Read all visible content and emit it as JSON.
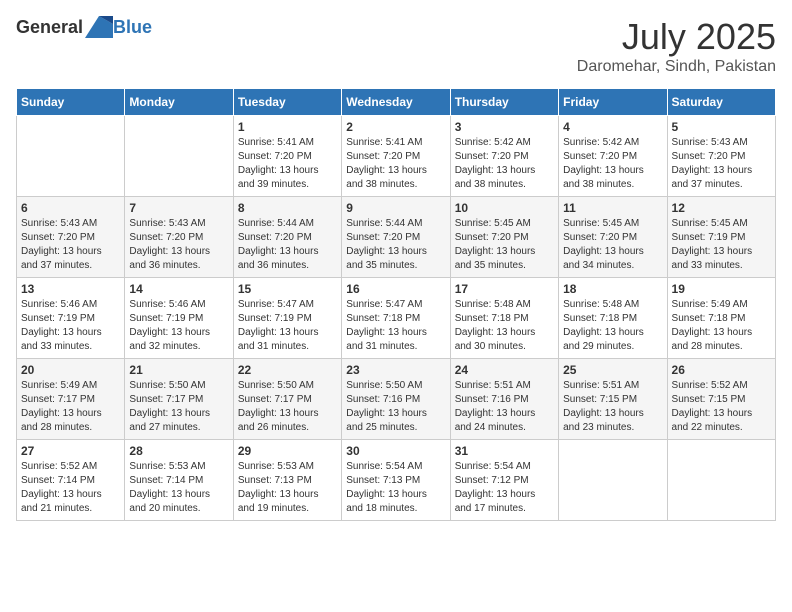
{
  "header": {
    "logo_general": "General",
    "logo_blue": "Blue",
    "month": "July 2025",
    "location": "Daromehar, Sindh, Pakistan"
  },
  "days_of_week": [
    "Sunday",
    "Monday",
    "Tuesday",
    "Wednesday",
    "Thursday",
    "Friday",
    "Saturday"
  ],
  "weeks": [
    [
      {
        "day": "",
        "info": ""
      },
      {
        "day": "",
        "info": ""
      },
      {
        "day": "1",
        "info": "Sunrise: 5:41 AM\nSunset: 7:20 PM\nDaylight: 13 hours and 39 minutes."
      },
      {
        "day": "2",
        "info": "Sunrise: 5:41 AM\nSunset: 7:20 PM\nDaylight: 13 hours and 38 minutes."
      },
      {
        "day": "3",
        "info": "Sunrise: 5:42 AM\nSunset: 7:20 PM\nDaylight: 13 hours and 38 minutes."
      },
      {
        "day": "4",
        "info": "Sunrise: 5:42 AM\nSunset: 7:20 PM\nDaylight: 13 hours and 38 minutes."
      },
      {
        "day": "5",
        "info": "Sunrise: 5:43 AM\nSunset: 7:20 PM\nDaylight: 13 hours and 37 minutes."
      }
    ],
    [
      {
        "day": "6",
        "info": "Sunrise: 5:43 AM\nSunset: 7:20 PM\nDaylight: 13 hours and 37 minutes."
      },
      {
        "day": "7",
        "info": "Sunrise: 5:43 AM\nSunset: 7:20 PM\nDaylight: 13 hours and 36 minutes."
      },
      {
        "day": "8",
        "info": "Sunrise: 5:44 AM\nSunset: 7:20 PM\nDaylight: 13 hours and 36 minutes."
      },
      {
        "day": "9",
        "info": "Sunrise: 5:44 AM\nSunset: 7:20 PM\nDaylight: 13 hours and 35 minutes."
      },
      {
        "day": "10",
        "info": "Sunrise: 5:45 AM\nSunset: 7:20 PM\nDaylight: 13 hours and 35 minutes."
      },
      {
        "day": "11",
        "info": "Sunrise: 5:45 AM\nSunset: 7:20 PM\nDaylight: 13 hours and 34 minutes."
      },
      {
        "day": "12",
        "info": "Sunrise: 5:45 AM\nSunset: 7:19 PM\nDaylight: 13 hours and 33 minutes."
      }
    ],
    [
      {
        "day": "13",
        "info": "Sunrise: 5:46 AM\nSunset: 7:19 PM\nDaylight: 13 hours and 33 minutes."
      },
      {
        "day": "14",
        "info": "Sunrise: 5:46 AM\nSunset: 7:19 PM\nDaylight: 13 hours and 32 minutes."
      },
      {
        "day": "15",
        "info": "Sunrise: 5:47 AM\nSunset: 7:19 PM\nDaylight: 13 hours and 31 minutes."
      },
      {
        "day": "16",
        "info": "Sunrise: 5:47 AM\nSunset: 7:18 PM\nDaylight: 13 hours and 31 minutes."
      },
      {
        "day": "17",
        "info": "Sunrise: 5:48 AM\nSunset: 7:18 PM\nDaylight: 13 hours and 30 minutes."
      },
      {
        "day": "18",
        "info": "Sunrise: 5:48 AM\nSunset: 7:18 PM\nDaylight: 13 hours and 29 minutes."
      },
      {
        "day": "19",
        "info": "Sunrise: 5:49 AM\nSunset: 7:18 PM\nDaylight: 13 hours and 28 minutes."
      }
    ],
    [
      {
        "day": "20",
        "info": "Sunrise: 5:49 AM\nSunset: 7:17 PM\nDaylight: 13 hours and 28 minutes."
      },
      {
        "day": "21",
        "info": "Sunrise: 5:50 AM\nSunset: 7:17 PM\nDaylight: 13 hours and 27 minutes."
      },
      {
        "day": "22",
        "info": "Sunrise: 5:50 AM\nSunset: 7:17 PM\nDaylight: 13 hours and 26 minutes."
      },
      {
        "day": "23",
        "info": "Sunrise: 5:50 AM\nSunset: 7:16 PM\nDaylight: 13 hours and 25 minutes."
      },
      {
        "day": "24",
        "info": "Sunrise: 5:51 AM\nSunset: 7:16 PM\nDaylight: 13 hours and 24 minutes."
      },
      {
        "day": "25",
        "info": "Sunrise: 5:51 AM\nSunset: 7:15 PM\nDaylight: 13 hours and 23 minutes."
      },
      {
        "day": "26",
        "info": "Sunrise: 5:52 AM\nSunset: 7:15 PM\nDaylight: 13 hours and 22 minutes."
      }
    ],
    [
      {
        "day": "27",
        "info": "Sunrise: 5:52 AM\nSunset: 7:14 PM\nDaylight: 13 hours and 21 minutes."
      },
      {
        "day": "28",
        "info": "Sunrise: 5:53 AM\nSunset: 7:14 PM\nDaylight: 13 hours and 20 minutes."
      },
      {
        "day": "29",
        "info": "Sunrise: 5:53 AM\nSunset: 7:13 PM\nDaylight: 13 hours and 19 minutes."
      },
      {
        "day": "30",
        "info": "Sunrise: 5:54 AM\nSunset: 7:13 PM\nDaylight: 13 hours and 18 minutes."
      },
      {
        "day": "31",
        "info": "Sunrise: 5:54 AM\nSunset: 7:12 PM\nDaylight: 13 hours and 17 minutes."
      },
      {
        "day": "",
        "info": ""
      },
      {
        "day": "",
        "info": ""
      }
    ]
  ]
}
